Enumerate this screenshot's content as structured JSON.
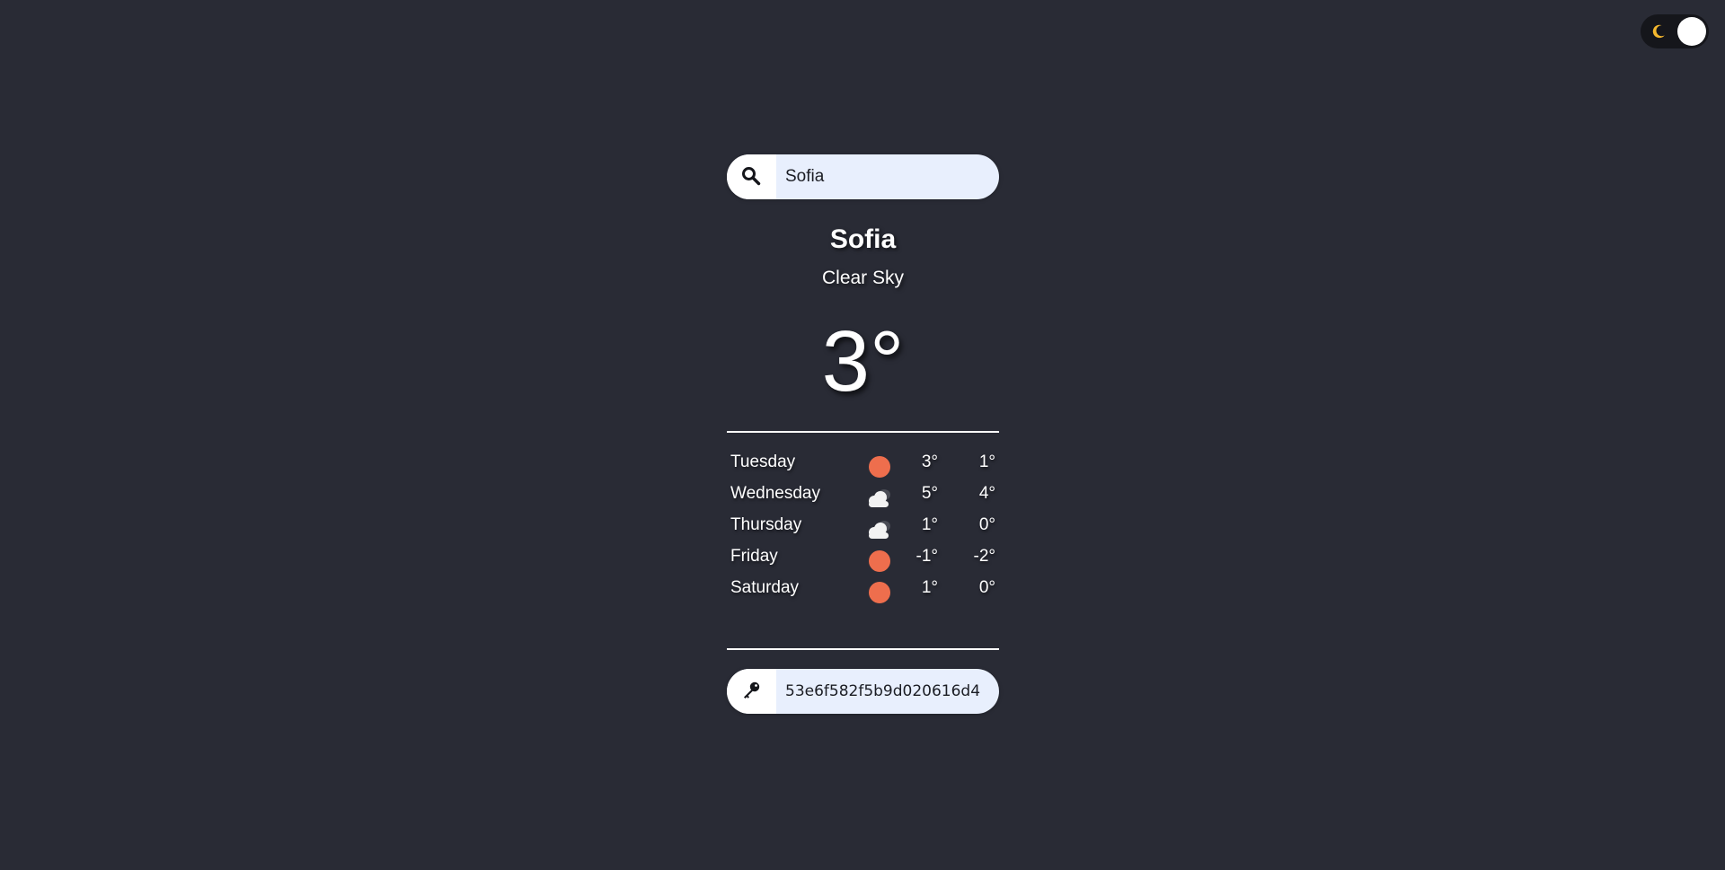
{
  "theme_toggle": {
    "icon": "moon-icon",
    "state": "dark",
    "accent": "#f5b82e"
  },
  "search": {
    "icon": "search-icon",
    "value": "Sofia",
    "placeholder": ""
  },
  "current": {
    "city": "Sofia",
    "condition": "Clear Sky",
    "temperature": "3°"
  },
  "forecast": [
    {
      "day": "Tuesday",
      "icon": "sun-icon",
      "max": "3°",
      "min": "1°"
    },
    {
      "day": "Wednesday",
      "icon": "cloud-icon",
      "max": "5°",
      "min": "4°"
    },
    {
      "day": "Thursday",
      "icon": "cloud-icon",
      "max": "1°",
      "min": "0°"
    },
    {
      "day": "Friday",
      "icon": "sun-icon",
      "max": "-1°",
      "min": "-2°"
    },
    {
      "day": "Saturday",
      "icon": "sun-icon",
      "max": "1°",
      "min": "0°"
    }
  ],
  "api_key": {
    "icon": "key-icon",
    "value": "53e6f582f5b9d020616d4"
  },
  "colors": {
    "background": "#292b35",
    "sun": "#ee6e4d",
    "input_bg": "#e8effd"
  }
}
